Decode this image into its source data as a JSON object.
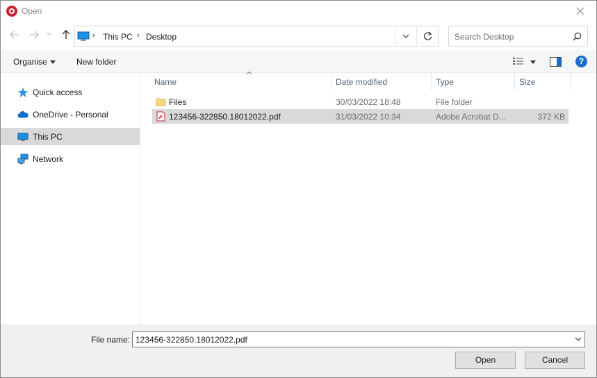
{
  "window": {
    "title": "Open",
    "close_icon": "close-icon"
  },
  "nav": {
    "back_icon": "arrow-left-icon",
    "forward_icon": "arrow-right-icon",
    "up_icon": "arrow-up-icon",
    "breadcrumb": [
      "This PC",
      "Desktop"
    ],
    "search_placeholder": "Search Desktop"
  },
  "toolbar": {
    "organise_label": "Organise",
    "new_folder_label": "New folder",
    "help_label": "?"
  },
  "sidebar": {
    "items": [
      {
        "label": "Quick access",
        "icon": "star-icon",
        "selected": false
      },
      {
        "label": "OneDrive - Personal",
        "icon": "cloud-icon",
        "selected": false
      },
      {
        "label": "This PC",
        "icon": "computer-icon",
        "selected": true
      },
      {
        "label": "Network",
        "icon": "network-icon",
        "selected": false
      }
    ]
  },
  "files": {
    "columns": [
      "Name",
      "Date modified",
      "Type",
      "Size"
    ],
    "rows": [
      {
        "name": "Files",
        "date": "30/03/2022 18:48",
        "type": "File folder",
        "size": "",
        "icon": "folder-icon",
        "selected": false
      },
      {
        "name": "123456-322850.18012022.pdf",
        "date": "31/03/2022 10:34",
        "type": "Adobe Acrobat D...",
        "size": "372 KB",
        "icon": "pdf-icon",
        "selected": true
      }
    ]
  },
  "footer": {
    "file_name_label": "File name:",
    "file_name_value": "123456-322850.18012022.pdf",
    "open_label": "Open",
    "cancel_label": "Cancel"
  },
  "colors": {
    "accent": "#1a6fc9",
    "selection": "#d9d9d9",
    "app_icon": "#c6232f"
  }
}
